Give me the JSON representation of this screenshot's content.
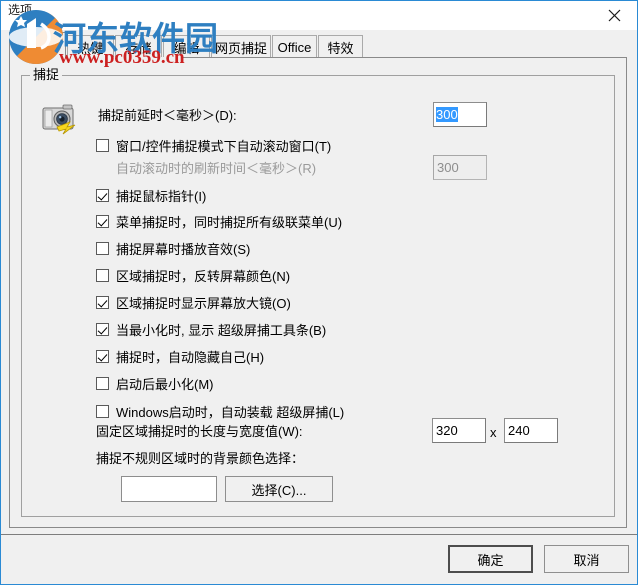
{
  "window": {
    "title": "选项",
    "close_icon": "close-icon",
    "accent_color": "#2a8ad4"
  },
  "tabs": [
    {
      "label": "捕捉",
      "active": true
    },
    {
      "label": "热键",
      "active": false
    },
    {
      "label": "存储",
      "active": false
    },
    {
      "label": "编辑",
      "active": false
    },
    {
      "label": "网页捕捉",
      "active": false
    },
    {
      "label": "Office",
      "active": false
    },
    {
      "label": "特效",
      "active": false
    }
  ],
  "group": {
    "legend": "捕捉",
    "camera_icon": "camera-icon"
  },
  "fields": {
    "delay_label": "捕捉前延时＜毫秒＞(D):",
    "delay_value": "300",
    "refresh_label": "自动滚动时的刷新时间＜毫秒＞(R)",
    "refresh_value": "300",
    "size_label": "固定区域捕捉时的长度与宽度值(W):",
    "size_width": "320",
    "size_sep": "x",
    "size_height": "240",
    "bgcolor_label": "捕捉不规则区域时的背景颜色选择：",
    "bgcolor_value": "#ffffff",
    "choose_button": "选择(C)..."
  },
  "checkboxes": [
    {
      "label": "窗口/控件捕捉模式下自动滚动窗口(T)",
      "checked": false
    },
    {
      "label": "捕捉鼠标指针(I)",
      "checked": true
    },
    {
      "label": "菜单捕捉时，同时捕捉所有级联菜单(U)",
      "checked": true
    },
    {
      "label": "捕捉屏幕时播放音效(S)",
      "checked": false
    },
    {
      "label": "区域捕捉时，反转屏幕颜色(N)",
      "checked": false
    },
    {
      "label": "区域捕捉时显示屏幕放大镜(O)",
      "checked": true
    },
    {
      "label": "当最小化时, 显示 超级屏捕工具条(B)",
      "checked": true
    },
    {
      "label": "捕捉时，自动隐藏自己(H)",
      "checked": true
    },
    {
      "label": "启动后最小化(M)",
      "checked": false
    },
    {
      "label": "Windows启动时，自动装载 超级屏捕(L)",
      "checked": false
    }
  ],
  "footer": {
    "ok_label": "确定",
    "cancel_label": "取消"
  },
  "watermark": {
    "logo_icon": "site-logo-icon",
    "site_name": "河东软件园",
    "site_url": "www.pc0359.cn"
  }
}
